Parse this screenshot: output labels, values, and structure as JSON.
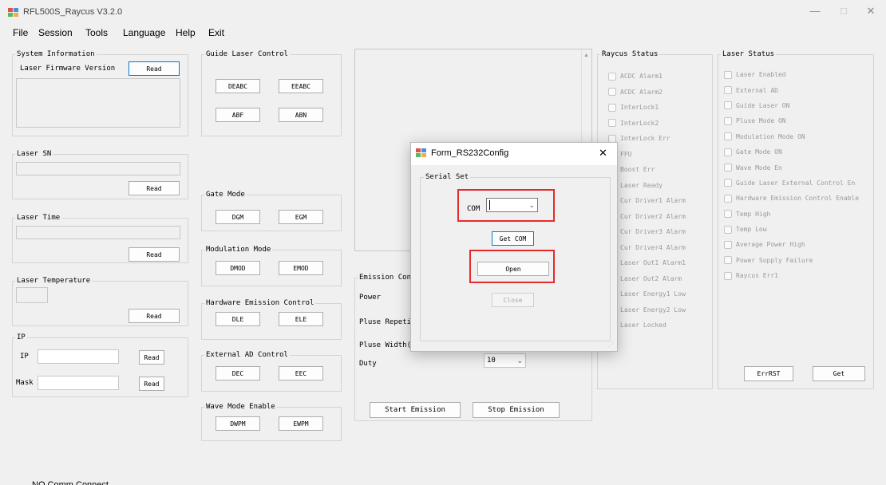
{
  "window": {
    "title": "RFL500S_Raycus V3.2.0",
    "controls": {
      "minimize": "—",
      "maximize": "□",
      "close": "✕"
    }
  },
  "menu": [
    "File",
    "Session",
    "Tools",
    "Language",
    "Help",
    "Exit"
  ],
  "system_info": {
    "title": "System Information",
    "fw_label": "Laser Firmware Version",
    "read": "Read"
  },
  "laser_sn": {
    "title": "Laser SN",
    "read": "Read"
  },
  "laser_time": {
    "title": "Laser Time",
    "read": "Read"
  },
  "laser_temp": {
    "title": "Laser Temperature",
    "read": "Read"
  },
  "ip": {
    "title": "IP",
    "ip_label": "IP",
    "mask_label": "Mask",
    "read": "Read"
  },
  "guide_laser": {
    "title": "Guide Laser Control",
    "buttons": [
      "DEABC",
      "EEABC",
      "ABF",
      "ABN"
    ]
  },
  "gate_mode": {
    "title": "Gate Mode",
    "buttons": [
      "DGM",
      "EGM"
    ]
  },
  "modulation_mode": {
    "title": "Modulation Mode",
    "buttons": [
      "DMOD",
      "EMOD"
    ]
  },
  "hw_emission": {
    "title": "Hardware Emission Control",
    "buttons": [
      "DLE",
      "ELE"
    ]
  },
  "ext_ad": {
    "title": "External AD Control",
    "buttons": [
      "DEC",
      "EEC"
    ]
  },
  "wave_mode": {
    "title": "Wave Mode Enable",
    "buttons": [
      "DWPM",
      "EWPM"
    ]
  },
  "emission": {
    "title": "Emission Con",
    "power": "Power",
    "pluse_rep": "Pluse Repeti",
    "pluse_width": "Pluse Width(",
    "duty": "Duty",
    "duty_value": "10",
    "start": "Start Emission",
    "stop": "Stop Emission"
  },
  "raycus_status": {
    "title": "Raycus Status",
    "items_checkbox": [
      "ACDC Alarm1",
      "ACDC Alarm2",
      "InterLock1",
      "InterLock2",
      "InterLock Err",
      "FFU"
    ],
    "items_plain": [
      "Boost Err",
      "Laser Ready",
      "Cur Driver1 Alarm",
      "Cur Driver2 Alarm",
      "Cur Driver3 Alarm",
      "Cur Driver4 Alarm",
      "Laser Out1 Alarm1",
      "Laser Out2 Alarm",
      "Laser Energy1 Low",
      "Laser Energy2 Low",
      "Laser Locked"
    ]
  },
  "laser_status": {
    "title": "Laser Status",
    "items": [
      "Laser Enabled",
      "External AD",
      "Guide Laser ON",
      "Pluse Mode ON",
      "Modulation Mode ON",
      "Gate Mode ON",
      "Wave Mode En",
      "Guide Laser External Control En",
      "Hardware Emission Control Enable",
      "Temp High",
      "Temp Low",
      "Average Power High",
      "Power Supply Failure",
      "Raycus Err1"
    ],
    "errrst": "ErrRST",
    "get": "Get"
  },
  "dialog": {
    "title": "Form_RS232Config",
    "close": "✕",
    "group": "Serial Set",
    "com_label": "COM",
    "com_value": "",
    "get_com": "Get COM",
    "open": "Open",
    "close_btn": "Close"
  },
  "statusbar": {
    "text": "NO Comm Connect"
  },
  "colors": {
    "highlight": "#e62a2a",
    "focus": "#0078d7"
  }
}
